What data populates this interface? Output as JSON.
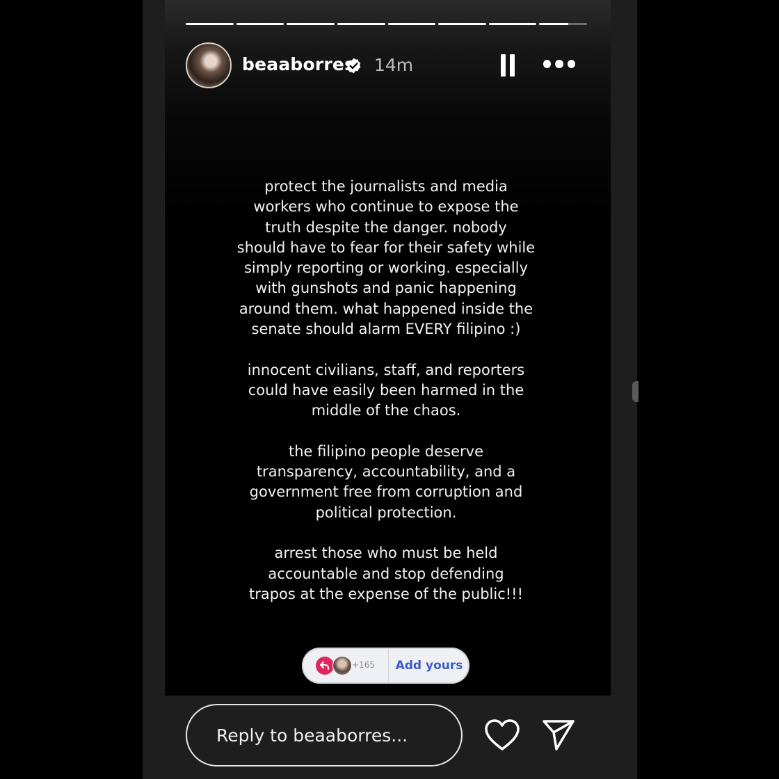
{
  "story": {
    "username": "beaaborres",
    "time_ago": "14m",
    "progress": {
      "segments": 8,
      "completed": 7,
      "current_fraction": 0.6
    }
  },
  "message": {
    "paragraphs": [
      "protect the journalists and media\nworkers who continue to expose the\ntruth despite the danger. nobody\nshould have to fear for their safety while\nsimply reporting or working. especially\nwith gunshots and panic happening\naround them. what happened inside the\nsenate should alarm EVERY filipino :)",
      "innocent civilians, staff, and reporters\ncould have easily been harmed in the\nmiddle of the chaos.",
      "the filipino people deserve\ntransparency, accountability, and a\ngovernment free from corruption and\npolitical protection.",
      "arrest those who must be held\naccountable and stop defending\ntrapos at the expense of the public!!!"
    ]
  },
  "add_yours": {
    "count": "+165",
    "label": "Add yours"
  },
  "reply": {
    "placeholder": "Reply to beaaborres..."
  },
  "icons": {
    "verified": "verified-badge-icon",
    "pause": "pause-icon",
    "more": "more-options-icon",
    "like": "heart-icon",
    "share": "send-icon",
    "add_yours_arrow": "reply-arrow-icon"
  },
  "colors": {
    "accent": "#3c5bc9",
    "badge": "#e0245e",
    "background": "#000000"
  }
}
